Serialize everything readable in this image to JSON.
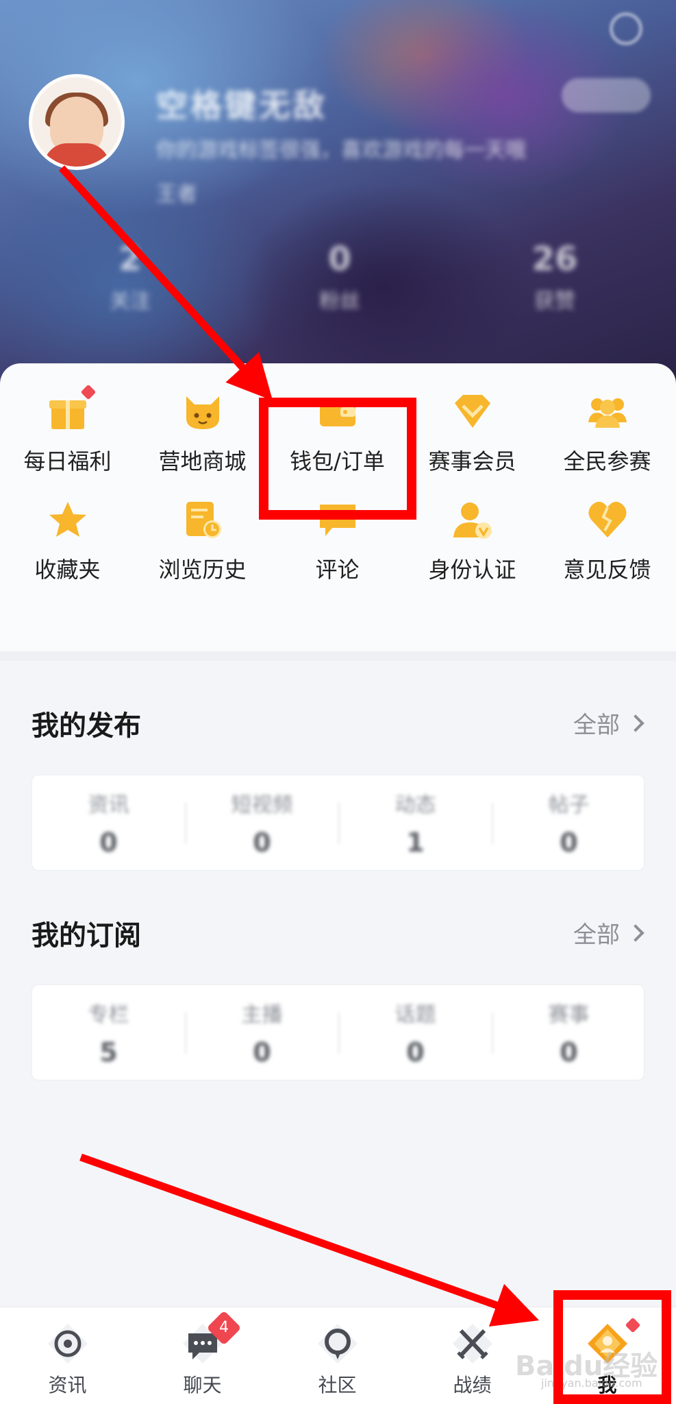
{
  "profile": {
    "name": "空格键无敌",
    "bio_line1": "你的游戏标签很强，喜欢游戏的每一天哦",
    "bio_line2": "王者",
    "stats": [
      {
        "value": "2",
        "label": "关注"
      },
      {
        "value": "0",
        "label": "粉丝"
      },
      {
        "value": "26",
        "label": "获赞"
      }
    ]
  },
  "grid": {
    "row1": [
      {
        "label": "每日福利",
        "icon": "gift-icon",
        "dot": true
      },
      {
        "label": "营地商城",
        "icon": "fox-mascot-icon",
        "dot": false
      },
      {
        "label": "钱包/订单",
        "icon": "wallet-icon",
        "dot": false
      },
      {
        "label": "赛事会员",
        "icon": "diamond-icon",
        "dot": false
      },
      {
        "label": "全民参赛",
        "icon": "group-icon",
        "dot": false
      }
    ],
    "row2": [
      {
        "label": "收藏夹",
        "icon": "star-icon",
        "dot": false
      },
      {
        "label": "浏览历史",
        "icon": "history-icon",
        "dot": false
      },
      {
        "label": "评论",
        "icon": "comment-icon",
        "dot": false
      },
      {
        "label": "身份认证",
        "icon": "verified-user-icon",
        "dot": false
      },
      {
        "label": "意见反馈",
        "icon": "broken-heart-icon",
        "dot": false
      }
    ]
  },
  "my_posts": {
    "title": "我的发布",
    "more": "全部",
    "cols": [
      {
        "label": "资讯",
        "value": "0"
      },
      {
        "label": "短视频",
        "value": "0"
      },
      {
        "label": "动态",
        "value": "1"
      },
      {
        "label": "帖子",
        "value": "0"
      }
    ]
  },
  "my_subs": {
    "title": "我的订阅",
    "more": "全部",
    "cols": [
      {
        "label": "专栏",
        "value": "5"
      },
      {
        "label": "主播",
        "value": "0"
      },
      {
        "label": "话题",
        "value": "0"
      },
      {
        "label": "赛事",
        "value": "0"
      }
    ]
  },
  "nav": [
    {
      "label": "资讯",
      "icon": "news-icon",
      "badge": ""
    },
    {
      "label": "聊天",
      "icon": "chat-icon",
      "badge": "4"
    },
    {
      "label": "社区",
      "icon": "community-icon",
      "badge": ""
    },
    {
      "label": "战绩",
      "icon": "crossed-swords-icon",
      "badge": ""
    },
    {
      "label": "我",
      "icon": "me-icon",
      "badge": ""
    }
  ],
  "watermark": {
    "main": "Baidu经验",
    "sub": "jingyan.baidu.com"
  },
  "colors": {
    "accent": "#f7b62b",
    "highlight": "#ff0000",
    "badge": "#f0464f"
  }
}
